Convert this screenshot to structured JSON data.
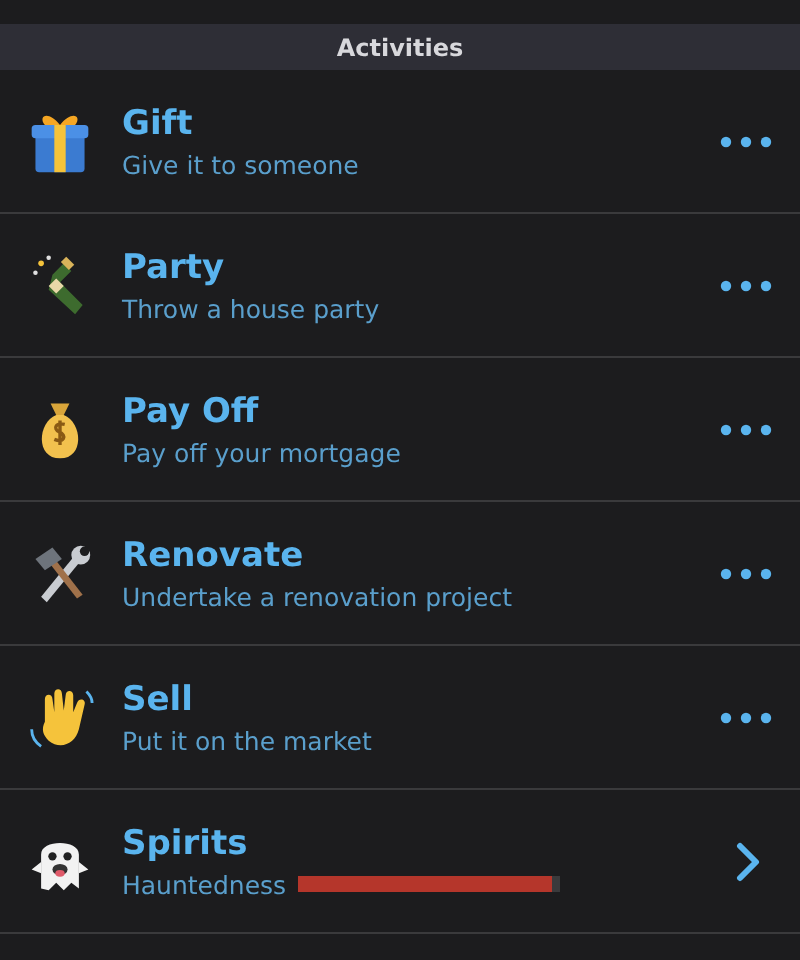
{
  "section": {
    "title": "Activities"
  },
  "rows": [
    {
      "kind": "action",
      "title": "Gift",
      "subtitle": "Give it to someone"
    },
    {
      "kind": "action",
      "title": "Party",
      "subtitle": "Throw a house party"
    },
    {
      "kind": "action",
      "title": "Pay Off",
      "subtitle": "Pay off your mortgage"
    },
    {
      "kind": "action",
      "title": "Renovate",
      "subtitle": "Undertake a renovation project"
    },
    {
      "kind": "action",
      "title": "Sell",
      "subtitle": "Put it on the market"
    },
    {
      "kind": "meter",
      "title": "Spirits",
      "subtitle": "Hauntedness",
      "level": 0.97
    }
  ]
}
